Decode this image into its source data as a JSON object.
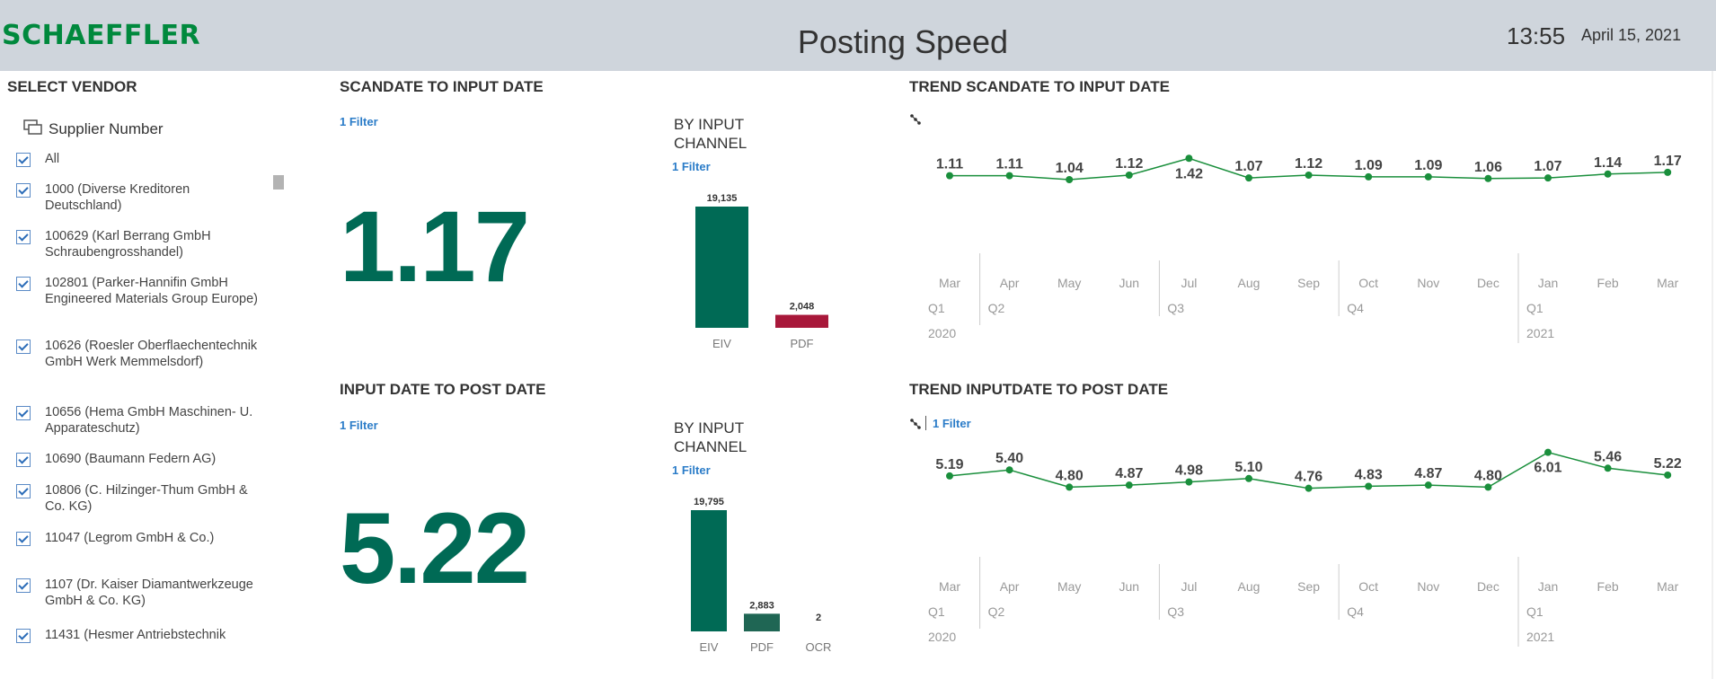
{
  "header": {
    "logo": "SCHAEFFLER",
    "title": "Posting Speed",
    "time": "13:55",
    "date": "April 15, 2021"
  },
  "vendor_panel": {
    "title": "SELECT VENDOR",
    "field_label": "Supplier Number",
    "items": [
      {
        "label": "All",
        "checked": true
      },
      {
        "label": "1000 (Diverse Kreditoren Deutschland)",
        "checked": true
      },
      {
        "label": "100629 (Karl Berrang GmbH Schraubengrosshandel)",
        "checked": true
      },
      {
        "label": "102801 (Parker-Hannifin GmbH Engineered Materials Group Europe)",
        "checked": true
      },
      {
        "label": "10626 (Roesler Oberflaechentechnik GmbH Werk Memmelsdorf)",
        "checked": true
      },
      {
        "label": "10656 (Hema GmbH Maschinen- U. Apparateschutz)",
        "checked": true
      },
      {
        "label": "10690 (Baumann Federn AG)",
        "checked": true
      },
      {
        "label": "10806 (C. Hilzinger-Thum GmbH & Co. KG)",
        "checked": true
      },
      {
        "label": "11047 (Legrom GmbH & Co.)",
        "checked": true
      },
      {
        "label": "1107 (Dr. Kaiser Diamantwerkzeuge GmbH & Co. KG)",
        "checked": true
      },
      {
        "label": "11431 (Hesmer Antriebstechnik",
        "checked": true
      }
    ]
  },
  "scan_section": {
    "title": "SCANDATE TO INPUT DATE",
    "filter": "1 Filter",
    "kpi": "1.17",
    "channel_title_line1": "BY INPUT",
    "channel_title_line2": "CHANNEL",
    "channel_filter": "1 Filter"
  },
  "post_section": {
    "title": "INPUT DATE TO POST DATE",
    "filter": "1 Filter",
    "kpi": "5.22",
    "channel_title_line1": "BY INPUT",
    "channel_title_line2": "CHANNEL",
    "channel_filter": "1 Filter"
  },
  "trend_scan": {
    "title": "TREND SCANDATE TO INPUT DATE"
  },
  "trend_post": {
    "title": "TREND INPUTDATE TO POST DATE",
    "filter": "1 Filter"
  },
  "colors": {
    "brand_green": "#00893d",
    "kpi_teal": "#006a55",
    "pdf_red": "#a8183a",
    "link_blue": "#2b7cc8",
    "header_bg": "#cfd5dc"
  },
  "chart_data": [
    {
      "id": "scan_channel",
      "type": "bar",
      "categories": [
        "EIV",
        "PDF"
      ],
      "values": [
        19135,
        2048
      ],
      "labels": [
        "19,135",
        "2,048"
      ],
      "colors": [
        "#006a55",
        "#a8183a"
      ]
    },
    {
      "id": "post_channel",
      "type": "bar",
      "categories": [
        "EIV",
        "PDF",
        "OCR"
      ],
      "values": [
        19795,
        2883,
        2
      ],
      "labels": [
        "19,795",
        "2,883",
        "2"
      ],
      "colors": [
        "#006a55",
        "#1f6654",
        "#006a55"
      ]
    },
    {
      "id": "trend_scan",
      "type": "line",
      "x": [
        "Mar",
        "Apr",
        "May",
        "Jun",
        "Jul",
        "Aug",
        "Sep",
        "Oct",
        "Nov",
        "Dec",
        "Jan",
        "Feb",
        "Mar"
      ],
      "values": [
        1.11,
        1.11,
        1.04,
        1.12,
        1.42,
        1.07,
        1.12,
        1.09,
        1.09,
        1.06,
        1.07,
        1.14,
        1.17
      ],
      "labels": [
        "1.11",
        "1.11",
        "1.04",
        "1.12",
        "1.42",
        "1.07",
        "1.12",
        "1.09",
        "1.09",
        "1.06",
        "1.07",
        "1.14",
        "1.17"
      ],
      "quarters": [
        "Q1",
        "Q2",
        "",
        "",
        "Q3",
        "",
        "",
        "Q4",
        "",
        "",
        "Q1",
        "",
        ""
      ],
      "years": [
        "2020",
        "",
        "",
        "",
        "",
        "",
        "",
        "",
        "",
        "",
        "2021",
        "",
        ""
      ],
      "color": "#1a8f3c"
    },
    {
      "id": "trend_post",
      "type": "line",
      "x": [
        "Mar",
        "Apr",
        "May",
        "Jun",
        "Jul",
        "Aug",
        "Sep",
        "Oct",
        "Nov",
        "Dec",
        "Jan",
        "Feb",
        "Mar"
      ],
      "values": [
        5.19,
        5.4,
        4.8,
        4.87,
        4.98,
        5.1,
        4.76,
        4.83,
        4.87,
        4.8,
        6.01,
        5.46,
        5.22
      ],
      "labels": [
        "5.19",
        "5.40",
        "4.80",
        "4.87",
        "4.98",
        "5.10",
        "4.76",
        "4.83",
        "4.87",
        "4.80",
        "6.01",
        "5.46",
        "5.22"
      ],
      "quarters": [
        "Q1",
        "Q2",
        "",
        "",
        "Q3",
        "",
        "",
        "Q4",
        "",
        "",
        "Q1",
        "",
        ""
      ],
      "years": [
        "2020",
        "",
        "",
        "",
        "",
        "",
        "",
        "",
        "",
        "",
        "2021",
        "",
        ""
      ],
      "color": "#1a8f3c"
    }
  ]
}
